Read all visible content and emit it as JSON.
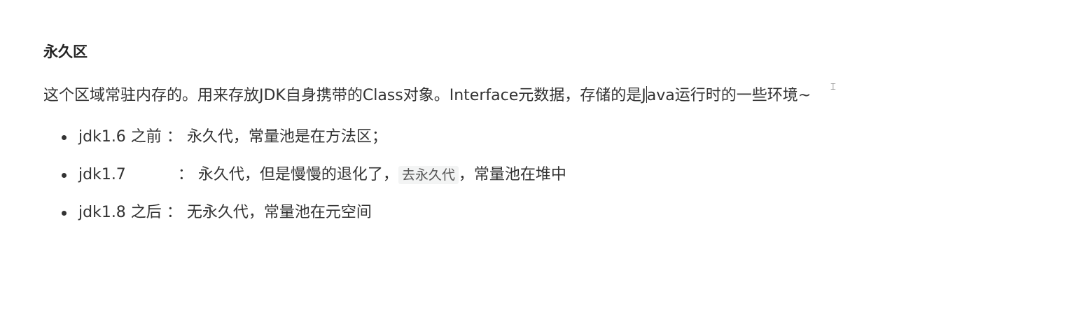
{
  "section": {
    "title": "永久区",
    "intro_before_caret": "这个区域常驻内存的。用来存放JDK自身携带的Class对象。Interface元数据，存储的是J",
    "intro_after_caret": "ava运行时的一些环境~",
    "items": [
      {
        "version": "jdk1.6 之前",
        "sep": "：",
        "text": " 永久代，常量池是在方法区；"
      },
      {
        "version": "jdk1.7",
        "sep": "：",
        "text_before": " 永久代，但是慢慢的退化了，",
        "code": "去永久代",
        "text_after": "，常量池在堆中"
      },
      {
        "version": "jdk1.8 之后",
        "sep": "：",
        "text": "无永久代，常量池在元空间"
      }
    ]
  },
  "icons": {
    "cursor": "text-cursor-icon"
  }
}
